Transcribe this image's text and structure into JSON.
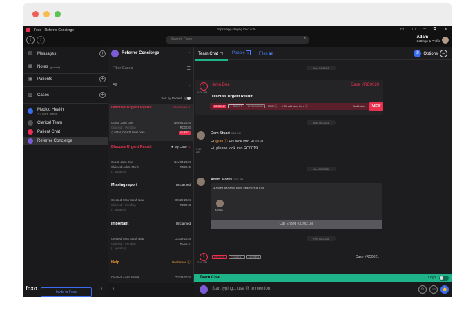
{
  "window": {
    "title": "Foxo - Referrer Concierge",
    "url": "https://app-staging.foxo.com"
  },
  "navbar": {
    "search_placeholder": "Search Foxo",
    "user_name": "Adam",
    "user_sub": "Settings & Profile"
  },
  "sidebar": {
    "messages": "Messages",
    "notes": "Notes",
    "notes_sub": "(private)",
    "patients": "Patients",
    "cases": "Cases",
    "org_name": "Medico Health",
    "org_sub": "+ 3 more Teams",
    "items": [
      {
        "label": "Clerical Team"
      },
      {
        "label": "Patient Chat"
      },
      {
        "label": "Referrer Concierge"
      }
    ],
    "invite": "Invite to Foxo",
    "brand": "foxo"
  },
  "cases_panel": {
    "header": "Referrer Concierge",
    "filter_placeholder": "Filter Cases",
    "select_value": "All",
    "sort_label": "Sort by Recent",
    "cases": [
      {
        "title": "Discuss Urgent Result",
        "status": "Unclaimed",
        "guest_line": "Guest: John Doe",
        "date": "Nov 04 2024",
        "claim_line": "Claimed: - Pending",
        "case_no": "RC0020",
        "mrn": "MRN, Or add label here",
        "tag": "GUEST"
      },
      {
        "title": "Discuss Urgent Result",
        "status": "My Case",
        "guest_line": "Guest: John Doe",
        "date": "Nov 04 2024",
        "claim_line": "Claimed: Adam Morris",
        "case_no": "RC0019",
        "extra": "(1 updates)"
      },
      {
        "title": "Missing report",
        "status": "Unclaimed",
        "guest_line": "Created: Miss Sarah New",
        "date": "Oct 29 2024",
        "claim_line": "Claimed: - Pending",
        "case_no": "RC0018",
        "extra": "(1 updates)"
      },
      {
        "title": "Important",
        "status": "Unclaimed",
        "guest_line": "Created: Miss Sarah New",
        "date": "Oct 29 2024",
        "claim_line": "Claimed: - Pending",
        "case_no": "RC0017",
        "extra": "(1 updates)"
      },
      {
        "title": "Help",
        "status": "Unclaimed",
        "guest_line": "Created: Adam Morris",
        "date": "Oct 29 2024"
      }
    ]
  },
  "chat": {
    "tabs": [
      {
        "label": "Team Chat"
      },
      {
        "label": "People",
        "count": "8"
      },
      {
        "label": "Files"
      }
    ],
    "options_label": "Options",
    "dates": [
      "Nov 04 2024",
      "Nov 06 2024",
      "Jan 20 2025",
      "Feb 05 2025"
    ],
    "case_message": {
      "author": "John Doe",
      "case_no": "Case #RC0020",
      "time": "4:09 PM",
      "title": "Discuss Urgent Result",
      "tags": [
        "URGENT",
        "GUEST",
        "UNCLAIMED",
        "MRN",
        "Or add label here"
      ],
      "add_label": "Add Label",
      "view": "VIEW"
    },
    "message1": {
      "author": "Dom Stuart",
      "time": "5:25 AM",
      "line1_prefix": "Hi",
      "mention": "@all",
      "line1_suffix": "Pls look into RC0020",
      "line2_time": "5:30 AM",
      "line2": "Hi, please look into RC0019"
    },
    "message2": {
      "author": "Adam Morris",
      "time": "2:57 PM",
      "call_header": "Adam Morris has started a call",
      "call_participant": "Adam",
      "call_ended": "Call Ended (00:00:18)"
    },
    "case_message2": {
      "tags": [
        "URGENT",
        "GUEST",
        "CLOSED"
      ],
      "case_no": "Case #RC0021",
      "time": "3:15 PM"
    },
    "team_chat_label": "Team Chat",
    "logs_label": "Logs",
    "composer_placeholder": "Start typing... use @ to mention"
  }
}
